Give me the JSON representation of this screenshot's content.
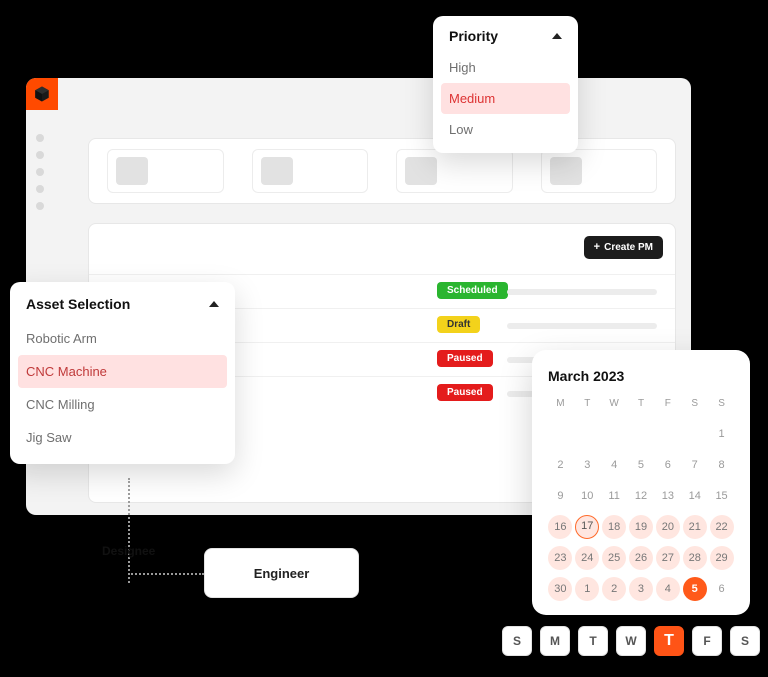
{
  "colors": {
    "brand": "#ff5416",
    "scheduled": "#2ab52f",
    "draft": "#f3d21b",
    "paused": "#e41c1c"
  },
  "toolbar": {
    "create_pm_label": "Create PM"
  },
  "priority": {
    "title": "Priority",
    "items": [
      "High",
      "Medium",
      "Low"
    ],
    "selected": "Medium"
  },
  "asset": {
    "title": "Asset Selection",
    "items": [
      "Robotic Arm",
      "CNC Machine",
      "CNC Milling",
      "Jig Saw"
    ],
    "selected": "CNC Machine"
  },
  "task_rows": [
    {
      "status": "Scheduled"
    },
    {
      "status": "Draft"
    },
    {
      "status": "Paused"
    },
    {
      "status": "Paused"
    }
  ],
  "designee": {
    "label": "Designee",
    "role": "Engineer"
  },
  "calendar": {
    "title": "March 2023",
    "dow": [
      "M",
      "T",
      "W",
      "T",
      "F",
      "S",
      "S"
    ],
    "cells": [
      {
        "n": "",
        "t": "blank"
      },
      {
        "n": "",
        "t": "blank"
      },
      {
        "n": "",
        "t": "blank"
      },
      {
        "n": "",
        "t": "blank"
      },
      {
        "n": "",
        "t": "blank"
      },
      {
        "n": "",
        "t": "blank"
      },
      {
        "n": "1",
        "t": ""
      },
      {
        "n": "2",
        "t": ""
      },
      {
        "n": "3",
        "t": ""
      },
      {
        "n": "4",
        "t": ""
      },
      {
        "n": "5",
        "t": ""
      },
      {
        "n": "6",
        "t": ""
      },
      {
        "n": "7",
        "t": ""
      },
      {
        "n": "8",
        "t": ""
      },
      {
        "n": "9",
        "t": ""
      },
      {
        "n": "10",
        "t": ""
      },
      {
        "n": "11",
        "t": ""
      },
      {
        "n": "12",
        "t": ""
      },
      {
        "n": "13",
        "t": ""
      },
      {
        "n": "14",
        "t": ""
      },
      {
        "n": "15",
        "t": ""
      },
      {
        "n": "16",
        "t": "range"
      },
      {
        "n": "17",
        "t": "ringed range"
      },
      {
        "n": "18",
        "t": "range"
      },
      {
        "n": "19",
        "t": "range"
      },
      {
        "n": "20",
        "t": "range"
      },
      {
        "n": "21",
        "t": "range"
      },
      {
        "n": "22",
        "t": "range"
      },
      {
        "n": "23",
        "t": "range"
      },
      {
        "n": "24",
        "t": "range"
      },
      {
        "n": "25",
        "t": "range"
      },
      {
        "n": "26",
        "t": "range"
      },
      {
        "n": "27",
        "t": "range"
      },
      {
        "n": "28",
        "t": "range"
      },
      {
        "n": "29",
        "t": "range"
      },
      {
        "n": "30",
        "t": "range"
      },
      {
        "n": "1",
        "t": "range"
      },
      {
        "n": "2",
        "t": "range"
      },
      {
        "n": "3",
        "t": "range"
      },
      {
        "n": "4",
        "t": "range"
      },
      {
        "n": "5",
        "t": "active"
      },
      {
        "n": "6",
        "t": ""
      }
    ]
  },
  "dow_strip": {
    "days": [
      "S",
      "M",
      "T",
      "W",
      "T",
      "F",
      "S"
    ],
    "active_index": 4
  }
}
